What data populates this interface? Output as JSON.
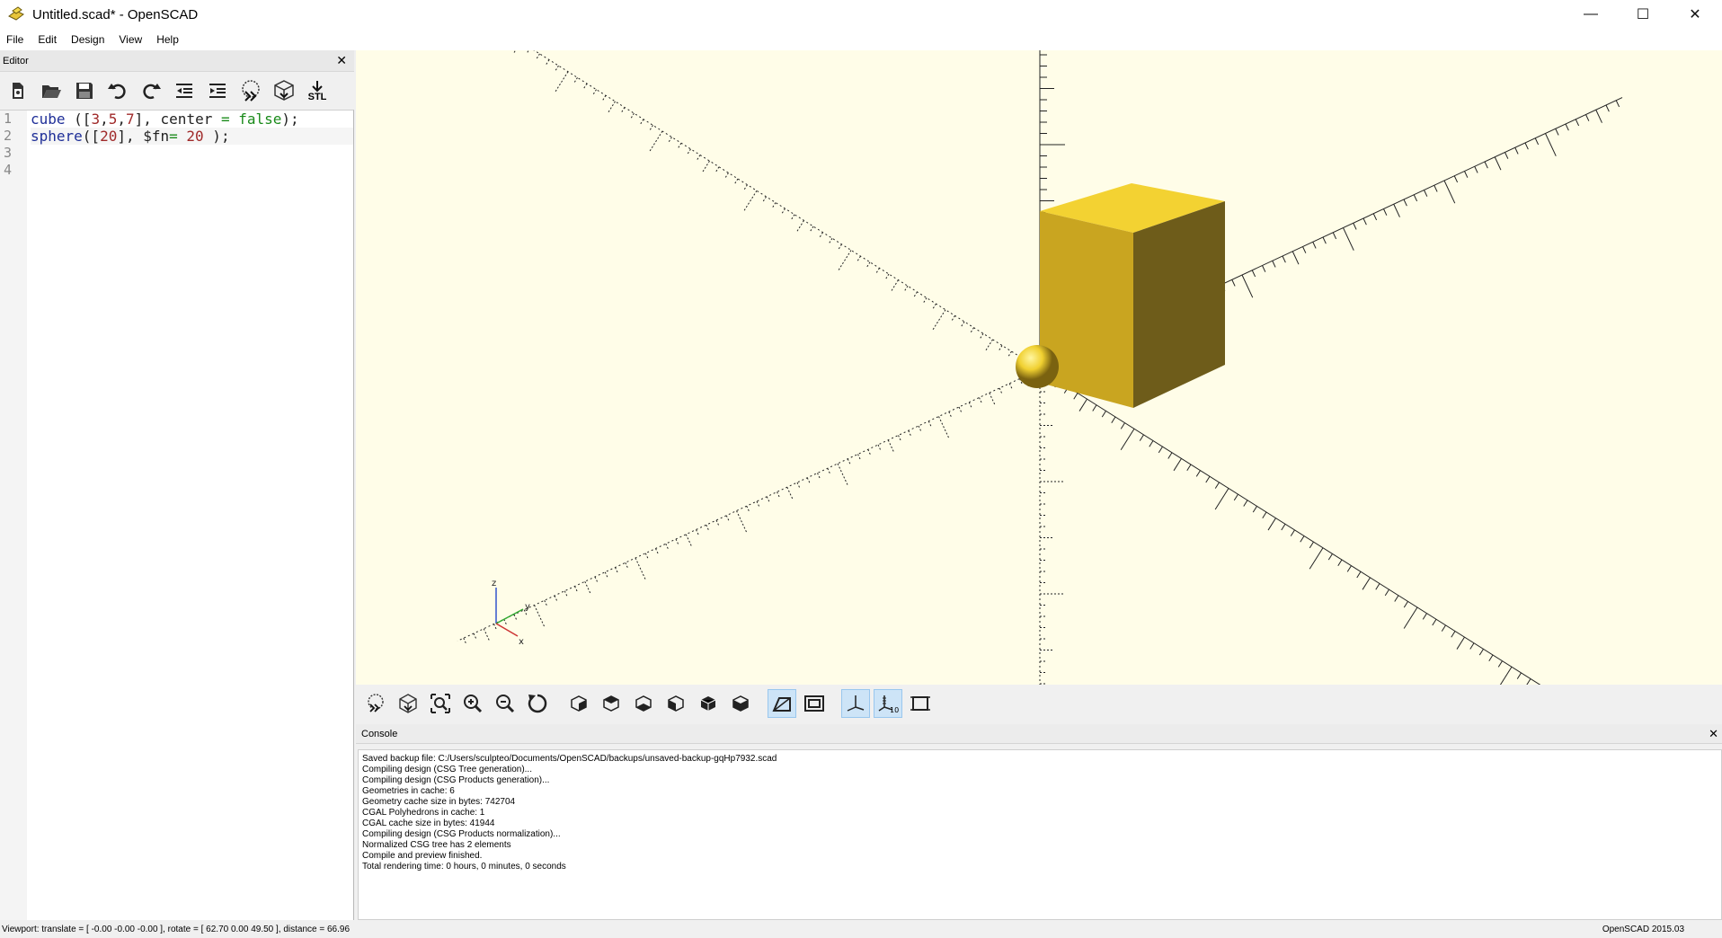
{
  "window": {
    "title": "Untitled.scad* - OpenSCAD",
    "min_glyph": "—",
    "max_glyph": "☐",
    "close_glyph": "✕"
  },
  "menu": {
    "items": [
      "File",
      "Edit",
      "Design",
      "View",
      "Help"
    ]
  },
  "editor": {
    "title": "Editor",
    "close_glyph": "✕",
    "toolbar": [
      "new-file-icon",
      "open-file-icon",
      "save-icon",
      "undo-icon",
      "redo-icon",
      "unindent-icon",
      "indent-icon",
      "preview-icon",
      "render-icon",
      "export-stl-icon"
    ],
    "stl_label": "STL",
    "line_numbers": [
      "1",
      "2",
      "3",
      "4"
    ],
    "lines": [
      [
        {
          "t": "cube",
          "c": "kw"
        },
        {
          "t": " ([",
          "c": "punc"
        },
        {
          "t": "3",
          "c": "num"
        },
        {
          "t": ",",
          "c": "punc"
        },
        {
          "t": "5",
          "c": "num"
        },
        {
          "t": ",",
          "c": "punc"
        },
        {
          "t": "7",
          "c": "num"
        },
        {
          "t": "], center ",
          "c": "punc"
        },
        {
          "t": "=",
          "c": "op"
        },
        {
          "t": " ",
          "c": "punc"
        },
        {
          "t": "false",
          "c": "bool"
        },
        {
          "t": ");",
          "c": "punc"
        }
      ],
      [
        {
          "t": "sphere",
          "c": "kw"
        },
        {
          "t": "([",
          "c": "punc"
        },
        {
          "t": "20",
          "c": "num"
        },
        {
          "t": "], $fn",
          "c": "punc"
        },
        {
          "t": "=",
          "c": "op"
        },
        {
          "t": " ",
          "c": "punc"
        },
        {
          "t": "20",
          "c": "num"
        },
        {
          "t": " );",
          "c": "punc"
        }
      ],
      [],
      []
    ]
  },
  "viewport": {
    "background": "#fffde8",
    "object_color": "#f0d030",
    "axis_labels": {
      "x": "x",
      "z": "z",
      "y": "y"
    }
  },
  "view_toolbar": {
    "buttons": [
      "preview-icon",
      "render-icon",
      "view-all-icon",
      "zoom-in-icon",
      "zoom-out-icon",
      "reset-view-icon",
      "view-right-icon",
      "view-top-icon",
      "view-bottom-icon",
      "view-left-icon",
      "view-front-icon",
      "view-back-icon",
      "perspective-icon",
      "orthogonal-icon",
      "show-axes-icon",
      "show-scale-markers-icon",
      "show-edges-icon"
    ],
    "active": [
      "perspective-icon",
      "show-axes-icon",
      "show-scale-markers-icon"
    ]
  },
  "console": {
    "title": "Console",
    "close_glyph": "✕",
    "lines": [
      "Saved backup file: C:/Users/sculpteo/Documents/OpenSCAD/backups/unsaved-backup-gqHp7932.scad",
      "Compiling design (CSG Tree generation)...",
      "Compiling design (CSG Products generation)...",
      "Geometries in cache: 6",
      "Geometry cache size in bytes: 742704",
      "CGAL Polyhedrons in cache: 1",
      "CGAL cache size in bytes: 41944",
      "Compiling design (CSG Products normalization)...",
      "Normalized CSG tree has 2 elements",
      "Compile and preview finished.",
      "Total rendering time: 0 hours, 0 minutes, 0 seconds"
    ]
  },
  "status": {
    "viewport": "Viewport: translate = [ -0.00 -0.00 -0.00 ], rotate = [ 62.70 0.00 49.50 ], distance = 66.96",
    "version": "OpenSCAD 2015.03"
  }
}
